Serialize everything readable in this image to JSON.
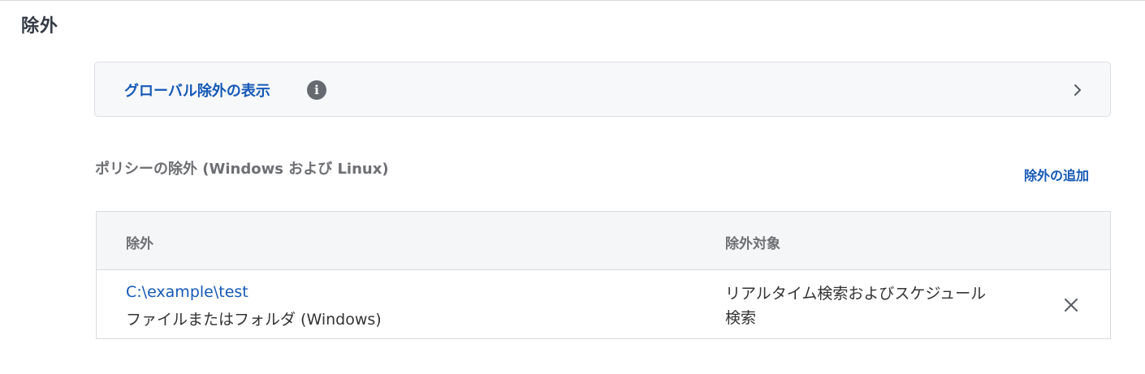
{
  "section": {
    "title": "除外"
  },
  "global_exclusions": {
    "label": "グローバル除外の表示",
    "info_icon": "info-icon",
    "chevron_icon": "chevron-right-icon"
  },
  "policy": {
    "title": "ポリシーの除外 (Windows および Linux)",
    "add_label": "除外の追加"
  },
  "table": {
    "headers": [
      "除外",
      "除外対象"
    ],
    "rows": [
      {
        "path": "C:\\example\\test",
        "type": "ファイルまたはフォルダ (Windows)",
        "target": "リアルタイム検索およびスケジュール検索",
        "remove_icon": "close-icon"
      }
    ]
  },
  "colors": {
    "link": "#1559b7",
    "heading": "#333a45",
    "muted": "#6d6f73",
    "panel_bg": "#f7f8fa",
    "border": "#d8dbdf"
  }
}
